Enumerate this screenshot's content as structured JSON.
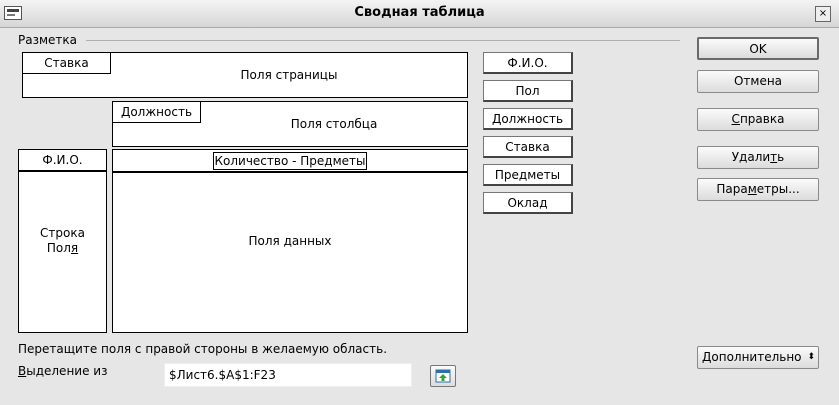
{
  "window": {
    "title": "Сводная таблица"
  },
  "layout": {
    "group_label": "Разметка",
    "page_fields_label": "Поля страницы",
    "page_field_buttons": [
      "Ставка"
    ],
    "column_fields_label": "Поля столбца",
    "column_field_buttons": [
      "Должность"
    ],
    "row_field_buttons": [
      "Ф.И.О."
    ],
    "row_fields_label_1": "Строка",
    "row_fields_label_2a": "Пол",
    "row_fields_label_2b": "я",
    "data_field_buttons": [
      "Количество - Предметы"
    ],
    "data_fields_label": "Поля данных"
  },
  "available_fields": [
    "Ф.И.О.",
    "Пол",
    "Должность",
    "Ставка",
    "Предметы",
    "Оклад"
  ],
  "buttons": {
    "ok": "OK",
    "cancel": "Отмена",
    "help_u": "С",
    "help_rest": "правка",
    "delete_pre": "Удали",
    "delete_u": "т",
    "delete_post": "ь",
    "options_pre": "Пара",
    "options_u": "м",
    "options_post": "етры...",
    "more": "Дополнительно"
  },
  "hint": "Перетащите поля с правой стороны в желаемую область.",
  "selection": {
    "label_u": "В",
    "label_rest": "ыделение из",
    "value": "$Лист6.$A$1:F23"
  }
}
